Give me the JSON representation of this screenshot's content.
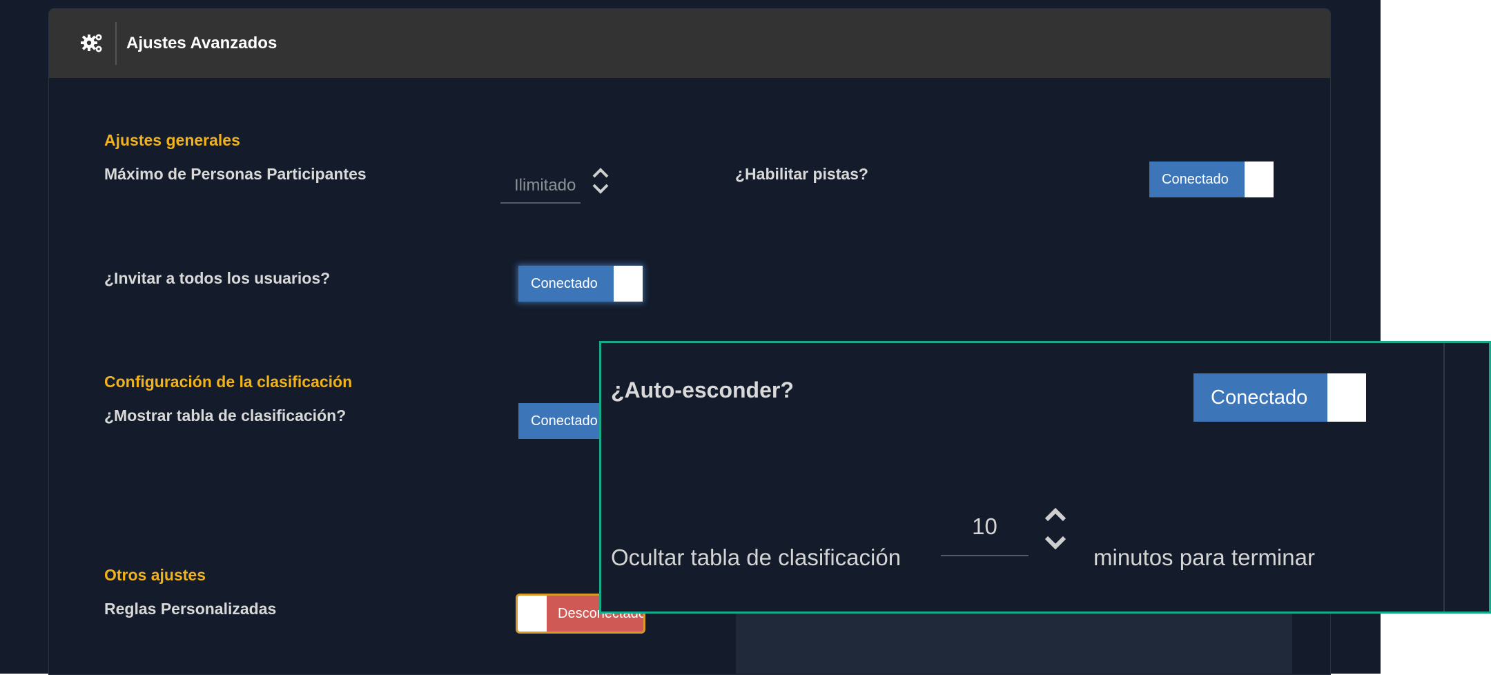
{
  "header": {
    "icon": "gears-icon",
    "title": "Ajustes Avanzados"
  },
  "general": {
    "section_title": "Ajustes generales",
    "max_participants_label": "Máximo de Personas Participantes",
    "max_participants_placeholder": "Ilimitado",
    "enable_hints_label": "¿Habilitar pistas?",
    "enable_hints_toggle": "Conectado",
    "invite_all_label": "¿Invitar a todos los usuarios?",
    "invite_all_toggle": "Conectado"
  },
  "leaderboard": {
    "section_title": "Configuración de la clasificación",
    "show_leaderboard_label": "¿Mostrar tabla de clasificación?",
    "show_leaderboard_toggle": "Conectado"
  },
  "other": {
    "section_title": "Otros ajustes",
    "custom_rules_label": "Reglas Personalizadas",
    "custom_rules_toggle": "Desconectado"
  },
  "zoom": {
    "auto_hide_label": "¿Auto-esconder?",
    "auto_hide_toggle": "Conectado",
    "hide_prefix": "Ocultar tabla de clasificación",
    "hide_minutes_value": "10",
    "hide_suffix": "minutos para terminar"
  },
  "colors": {
    "accent": "#f2b21a",
    "toggle_on": "#3d76b8",
    "toggle_off": "#cf5a55",
    "highlight": "#16a98a"
  }
}
